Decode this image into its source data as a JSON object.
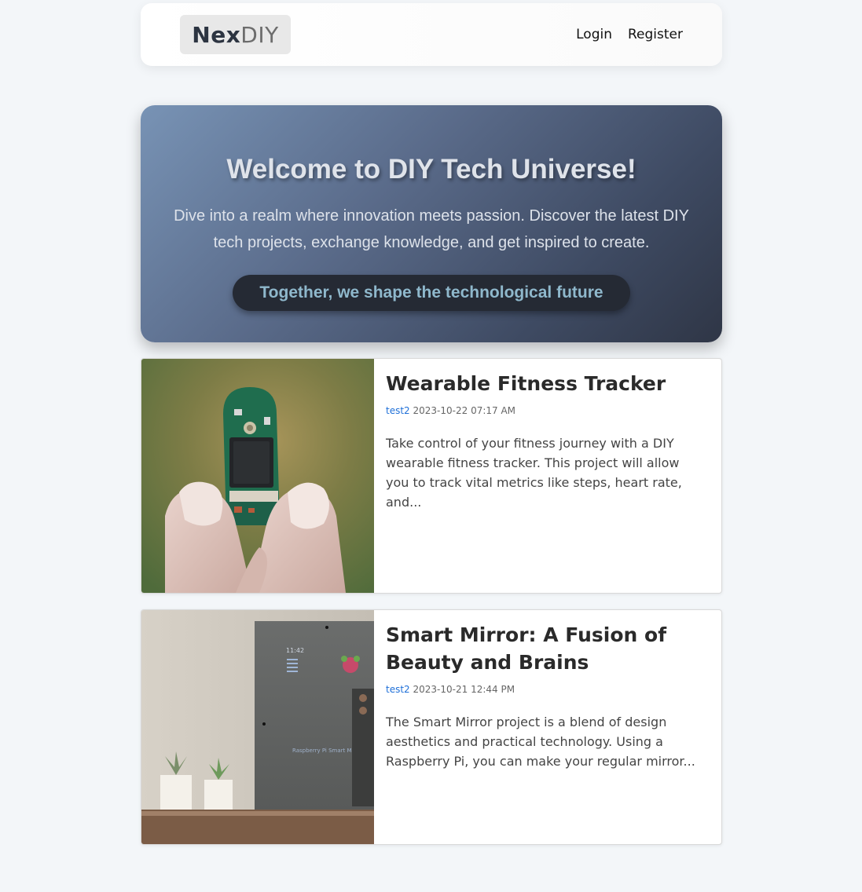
{
  "nav": {
    "logo_part1": "Nex",
    "logo_part2": "DIY",
    "login": "Login",
    "register": "Register"
  },
  "hero": {
    "title": "Welcome to DIY Tech Universe!",
    "subtitle": "Dive into a realm where innovation meets passion. Discover the latest DIY tech projects, exchange knowledge, and get inspired to create.",
    "tagline": "Together, we shape the technological future"
  },
  "posts": [
    {
      "title": "Wearable Fitness Tracker",
      "author": "test2",
      "date": "2023-10-22 07:17 AM",
      "excerpt": "Take control of your fitness journey with a DIY wearable fitness tracker. This project will allow you to track vital metrics like steps, heart rate, and..."
    },
    {
      "title": "Smart Mirror: A Fusion of Beauty and Brains",
      "author": "test2",
      "date": "2023-10-21 12:44 PM",
      "excerpt": "The Smart Mirror project is a blend of design aesthetics and practical technology. Using a Raspberry Pi, you can make your regular mirror...",
      "image_text": {
        "clock": "11:42",
        "mirror_label": "Raspberry Pi Smart Mirror"
      }
    }
  ],
  "colors": {
    "page_bg": "#f3f6f9",
    "author_link": "#1e6fd8",
    "hero_tagline": "#8fb8cc"
  }
}
